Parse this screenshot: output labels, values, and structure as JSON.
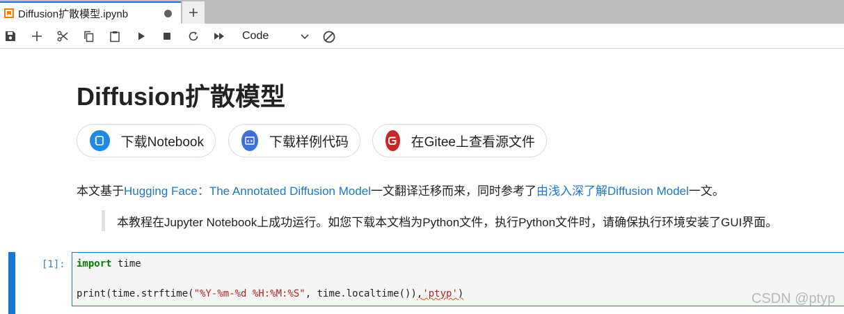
{
  "tab": {
    "title": "Diffusion扩散模型.ipynb"
  },
  "toolbar": {
    "cell_type": "Code"
  },
  "notebook": {
    "heading": "Diffusion扩散模型",
    "links": [
      {
        "label": "下载Notebook",
        "icon": "notebook-icon",
        "color": "#1e88e5"
      },
      {
        "label": "下载样例代码",
        "icon": "code-icon",
        "color": "#3f6fd8"
      },
      {
        "label": "在Gitee上查看源文件",
        "icon": "gitee-icon",
        "color": "#c62828"
      }
    ],
    "paragraph": {
      "prefix": "本文基于",
      "link1": "Hugging Face：The Annotated Diffusion Model",
      "middle": "一文翻译迁移而来，同时参考了",
      "link2": "由浅入深了解Diffusion Model",
      "suffix": "一文。"
    },
    "quote": "本教程在Jupyter Notebook上成功运行。如您下载本文档为Python文件，执行Python文件时，请确保执行环境安装了GUI界面。"
  },
  "code_cell": {
    "prompt": "[1]:",
    "line1_kw": "import",
    "line1_rest": " time",
    "line2_a": "print(time.strftime(",
    "line2_fmt": "\"%Y-%m-%d %H:%M:%S\"",
    "line2_b": ", time.localtime())",
    "line2_c": ",",
    "line2_str": "'ptyp'",
    "line2_d": ")"
  },
  "watermark": "CSDN @ptyp",
  "colors": {
    "accent": "#1976d2",
    "link": "#1976d2",
    "keyword": "#008000",
    "string": "#ba2121"
  }
}
